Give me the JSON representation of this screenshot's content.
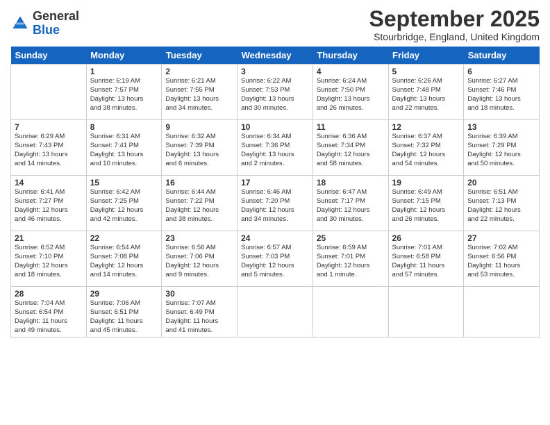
{
  "header": {
    "logo_general": "General",
    "logo_blue": "Blue",
    "month_title": "September 2025",
    "location": "Stourbridge, England, United Kingdom"
  },
  "days_of_week": [
    "Sunday",
    "Monday",
    "Tuesday",
    "Wednesday",
    "Thursday",
    "Friday",
    "Saturday"
  ],
  "weeks": [
    [
      {
        "day": "",
        "info": ""
      },
      {
        "day": "1",
        "info": "Sunrise: 6:19 AM\nSunset: 7:57 PM\nDaylight: 13 hours\nand 38 minutes."
      },
      {
        "day": "2",
        "info": "Sunrise: 6:21 AM\nSunset: 7:55 PM\nDaylight: 13 hours\nand 34 minutes."
      },
      {
        "day": "3",
        "info": "Sunrise: 6:22 AM\nSunset: 7:53 PM\nDaylight: 13 hours\nand 30 minutes."
      },
      {
        "day": "4",
        "info": "Sunrise: 6:24 AM\nSunset: 7:50 PM\nDaylight: 13 hours\nand 26 minutes."
      },
      {
        "day": "5",
        "info": "Sunrise: 6:26 AM\nSunset: 7:48 PM\nDaylight: 13 hours\nand 22 minutes."
      },
      {
        "day": "6",
        "info": "Sunrise: 6:27 AM\nSunset: 7:46 PM\nDaylight: 13 hours\nand 18 minutes."
      }
    ],
    [
      {
        "day": "7",
        "info": "Sunrise: 6:29 AM\nSunset: 7:43 PM\nDaylight: 13 hours\nand 14 minutes."
      },
      {
        "day": "8",
        "info": "Sunrise: 6:31 AM\nSunset: 7:41 PM\nDaylight: 13 hours\nand 10 minutes."
      },
      {
        "day": "9",
        "info": "Sunrise: 6:32 AM\nSunset: 7:39 PM\nDaylight: 13 hours\nand 6 minutes."
      },
      {
        "day": "10",
        "info": "Sunrise: 6:34 AM\nSunset: 7:36 PM\nDaylight: 13 hours\nand 2 minutes."
      },
      {
        "day": "11",
        "info": "Sunrise: 6:36 AM\nSunset: 7:34 PM\nDaylight: 12 hours\nand 58 minutes."
      },
      {
        "day": "12",
        "info": "Sunrise: 6:37 AM\nSunset: 7:32 PM\nDaylight: 12 hours\nand 54 minutes."
      },
      {
        "day": "13",
        "info": "Sunrise: 6:39 AM\nSunset: 7:29 PM\nDaylight: 12 hours\nand 50 minutes."
      }
    ],
    [
      {
        "day": "14",
        "info": "Sunrise: 6:41 AM\nSunset: 7:27 PM\nDaylight: 12 hours\nand 46 minutes."
      },
      {
        "day": "15",
        "info": "Sunrise: 6:42 AM\nSunset: 7:25 PM\nDaylight: 12 hours\nand 42 minutes."
      },
      {
        "day": "16",
        "info": "Sunrise: 6:44 AM\nSunset: 7:22 PM\nDaylight: 12 hours\nand 38 minutes."
      },
      {
        "day": "17",
        "info": "Sunrise: 6:46 AM\nSunset: 7:20 PM\nDaylight: 12 hours\nand 34 minutes."
      },
      {
        "day": "18",
        "info": "Sunrise: 6:47 AM\nSunset: 7:17 PM\nDaylight: 12 hours\nand 30 minutes."
      },
      {
        "day": "19",
        "info": "Sunrise: 6:49 AM\nSunset: 7:15 PM\nDaylight: 12 hours\nand 26 minutes."
      },
      {
        "day": "20",
        "info": "Sunrise: 6:51 AM\nSunset: 7:13 PM\nDaylight: 12 hours\nand 22 minutes."
      }
    ],
    [
      {
        "day": "21",
        "info": "Sunrise: 6:52 AM\nSunset: 7:10 PM\nDaylight: 12 hours\nand 18 minutes."
      },
      {
        "day": "22",
        "info": "Sunrise: 6:54 AM\nSunset: 7:08 PM\nDaylight: 12 hours\nand 14 minutes."
      },
      {
        "day": "23",
        "info": "Sunrise: 6:56 AM\nSunset: 7:06 PM\nDaylight: 12 hours\nand 9 minutes."
      },
      {
        "day": "24",
        "info": "Sunrise: 6:57 AM\nSunset: 7:03 PM\nDaylight: 12 hours\nand 5 minutes."
      },
      {
        "day": "25",
        "info": "Sunrise: 6:59 AM\nSunset: 7:01 PM\nDaylight: 12 hours\nand 1 minute."
      },
      {
        "day": "26",
        "info": "Sunrise: 7:01 AM\nSunset: 6:58 PM\nDaylight: 11 hours\nand 57 minutes."
      },
      {
        "day": "27",
        "info": "Sunrise: 7:02 AM\nSunset: 6:56 PM\nDaylight: 11 hours\nand 53 minutes."
      }
    ],
    [
      {
        "day": "28",
        "info": "Sunrise: 7:04 AM\nSunset: 6:54 PM\nDaylight: 11 hours\nand 49 minutes."
      },
      {
        "day": "29",
        "info": "Sunrise: 7:06 AM\nSunset: 6:51 PM\nDaylight: 11 hours\nand 45 minutes."
      },
      {
        "day": "30",
        "info": "Sunrise: 7:07 AM\nSunset: 6:49 PM\nDaylight: 11 hours\nand 41 minutes."
      },
      {
        "day": "",
        "info": ""
      },
      {
        "day": "",
        "info": ""
      },
      {
        "day": "",
        "info": ""
      },
      {
        "day": "",
        "info": ""
      }
    ]
  ]
}
